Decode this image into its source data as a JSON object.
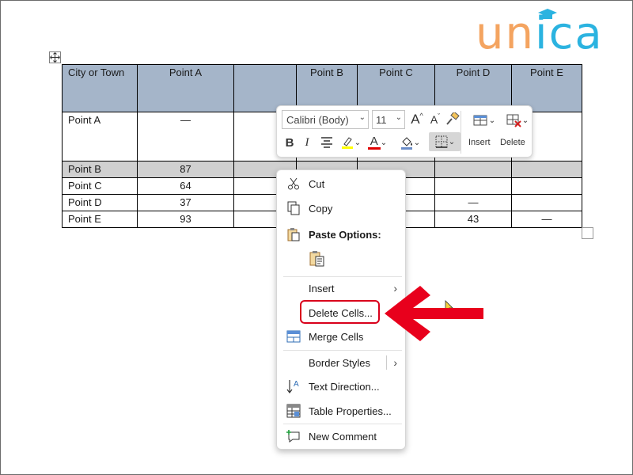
{
  "logo": {
    "text": "unica"
  },
  "table": {
    "header": [
      "City or Town",
      "Point A",
      "",
      "Point B",
      "Point C",
      "Point D",
      "Point E"
    ],
    "rows": [
      [
        "Point A",
        "—",
        "",
        "",
        "",
        "",
        ""
      ],
      [
        "Point B",
        "87",
        "",
        "",
        "",
        "",
        ""
      ],
      [
        "Point C",
        "64",
        "",
        "",
        "",
        "",
        ""
      ],
      [
        "Point D",
        "37",
        "",
        "",
        "",
        "—",
        ""
      ],
      [
        "Point E",
        "93",
        "",
        "",
        "",
        "43",
        "—"
      ]
    ]
  },
  "mini_toolbar": {
    "font_name": "Calibri (Body)",
    "font_size": "11",
    "insert_label": "Insert",
    "delete_label": "Delete",
    "grow_font": "A",
    "shrink_font": "A",
    "bold": "B",
    "italic": "I",
    "font_color_letter": "A",
    "highlight_color": "#ffff00",
    "font_color": "#e00000"
  },
  "context_menu": {
    "items": [
      {
        "label": "Cut",
        "icon": "scissors-icon"
      },
      {
        "label": "Copy",
        "icon": "copy-icon"
      },
      {
        "label": "Paste Options:",
        "icon": "paste-icon"
      },
      {
        "label": "Insert",
        "icon": ""
      },
      {
        "label": "Delete Cells...",
        "icon": ""
      },
      {
        "label": "Merge Cells",
        "icon": "merge-cells-icon"
      },
      {
        "label": "Border Styles",
        "icon": ""
      },
      {
        "label": "Text Direction...",
        "icon": "text-direction-icon"
      },
      {
        "label": "Table Properties...",
        "icon": "table-properties-icon"
      },
      {
        "label": "New Comment",
        "icon": "new-comment-icon"
      }
    ]
  },
  "colors": {
    "header_fill": "#a5b5c9",
    "selected_row": "#d0d0d0",
    "annotation_red": "#d9001b"
  }
}
